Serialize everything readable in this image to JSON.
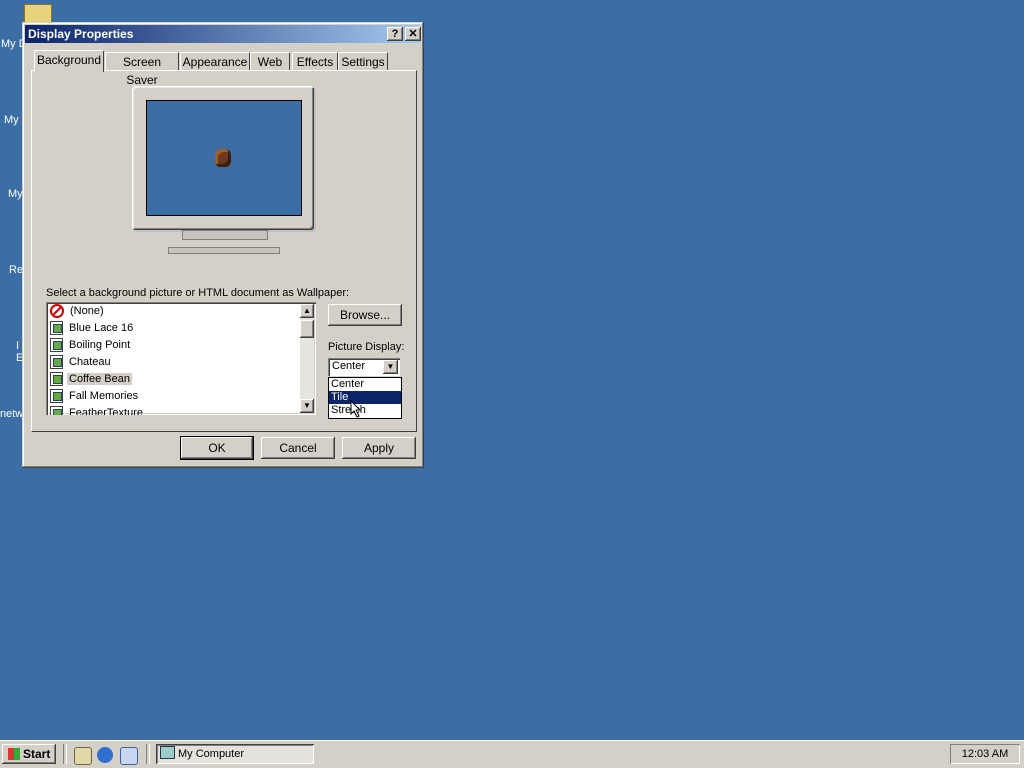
{
  "desktop": {
    "icons": [
      {
        "label": "My D"
      },
      {
        "label": "My"
      },
      {
        "label": "My"
      },
      {
        "label": "Re"
      },
      {
        "label": "I"
      },
      {
        "label": "E"
      },
      {
        "label": "netw"
      }
    ]
  },
  "window": {
    "title": "Display Properties",
    "help_glyph": "?",
    "close_glyph": "✕",
    "tabs": [
      {
        "label": "Background",
        "active": true
      },
      {
        "label": "Screen Saver"
      },
      {
        "label": "Appearance"
      },
      {
        "label": "Web"
      },
      {
        "label": "Effects"
      },
      {
        "label": "Settings"
      }
    ],
    "wallpaper_prompt": "Select a background picture or HTML document as Wallpaper:",
    "wallpapers": [
      {
        "label": "(None)",
        "icon": "none-icon"
      },
      {
        "label": "Blue Lace 16",
        "icon": "bitmap-icon"
      },
      {
        "label": "Boiling Point",
        "icon": "bitmap-icon"
      },
      {
        "label": "Chateau",
        "icon": "bitmap-icon"
      },
      {
        "label": "Coffee Bean",
        "icon": "bitmap-icon",
        "selected": true
      },
      {
        "label": "Fall Memories",
        "icon": "bitmap-icon"
      },
      {
        "label": "FeatherTexture",
        "icon": "bitmap-icon"
      }
    ],
    "browse_label": "Browse...",
    "picture_display_label": "Picture Display:",
    "picture_display_value": "Center",
    "picture_display_options": [
      "Center",
      "Tile",
      "Stretch"
    ],
    "picture_display_highlighted": "Tile",
    "ok_label": "OK",
    "cancel_label": "Cancel",
    "apply_label": "Apply"
  },
  "taskbar": {
    "start_label": "Start",
    "tasks": [
      {
        "label": "My Computer"
      }
    ],
    "clock": "12:03 AM"
  },
  "colors": {
    "desktop": "#3a6ea5",
    "title_start": "#0a246a",
    "title_end": "#a6caf0",
    "face": "#d4d0c8"
  }
}
